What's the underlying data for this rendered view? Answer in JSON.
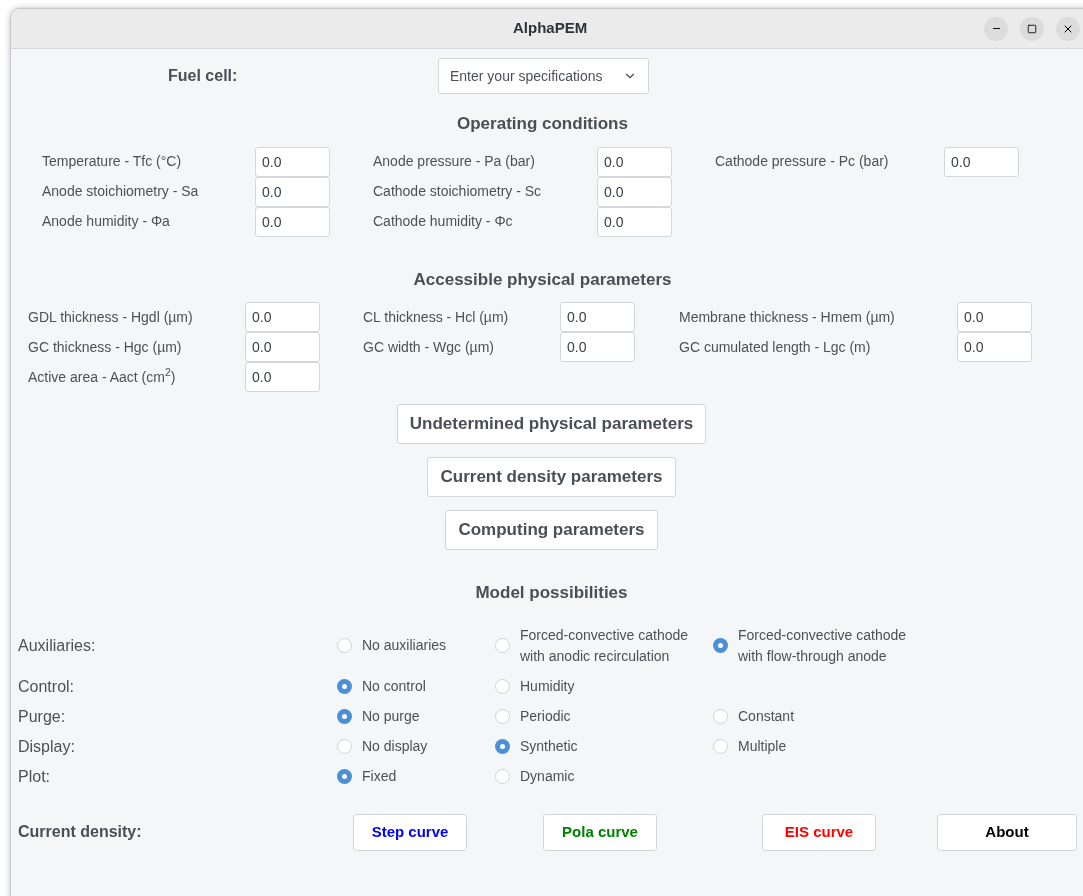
{
  "window": {
    "title": "AlphaPEM"
  },
  "fuel_cell": {
    "label": "Fuel cell:",
    "dropdown": {
      "value": "Enter your specifications"
    }
  },
  "operating_conditions": {
    "title": "Operating conditions",
    "fields": [
      {
        "label": "Temperature - Tfc (°C)",
        "value": "0.0"
      },
      {
        "label": "Anode pressure - Pa (bar)",
        "value": "0.0"
      },
      {
        "label": "Cathode pressure - Pc (bar)",
        "value": "0.0"
      },
      {
        "label": "Anode stoichiometry - Sa",
        "value": "0.0"
      },
      {
        "label": "Cathode stoichiometry - Sc",
        "value": "0.0"
      },
      {
        "label": "Anode humidity - Φa",
        "value": "0.0"
      },
      {
        "label": "Cathode humidity - Φc",
        "value": "0.0"
      }
    ]
  },
  "physical_parameters": {
    "title": "Accessible physical parameters",
    "fields": [
      {
        "label": "GDL thickness - Hgdl (µm)",
        "value": "0.0"
      },
      {
        "label": "CL thickness - Hcl (µm)",
        "value": "0.0"
      },
      {
        "label": "Membrane thickness - Hmem (µm)",
        "value": "0.0"
      },
      {
        "label": "GC thickness - Hgc (µm)",
        "value": "0.0"
      },
      {
        "label": "GC width - Wgc (µm)",
        "value": "0.0"
      },
      {
        "label": "GC cumulated length - Lgc (m)",
        "value": "0.0"
      },
      {
        "label": "Active area - Aact (cm$^{2}$)",
        "value": "0.0"
      }
    ]
  },
  "section_buttons": [
    "Undetermined physical parameters",
    "Current density parameters",
    "Computing parameters"
  ],
  "model_possibilities": {
    "title": "Model possibilities",
    "rows": [
      {
        "label": "Auxiliaries:",
        "options": [
          {
            "label": "No auxiliaries",
            "selected": false
          },
          {
            "label": "Forced-convective cathode\nwith anodic recirculation",
            "selected": false
          },
          {
            "label": "Forced-convective cathode\nwith flow-through anode",
            "selected": true
          }
        ]
      },
      {
        "label": "Control:",
        "options": [
          {
            "label": "No control",
            "selected": true
          },
          {
            "label": "Humidity",
            "selected": false
          }
        ]
      },
      {
        "label": "Purge:",
        "options": [
          {
            "label": "No purge",
            "selected": true
          },
          {
            "label": "Periodic",
            "selected": false
          },
          {
            "label": "Constant",
            "selected": false
          }
        ]
      },
      {
        "label": "Display:",
        "options": [
          {
            "label": "No display",
            "selected": false
          },
          {
            "label": "Synthetic",
            "selected": true
          },
          {
            "label": "Multiple",
            "selected": false
          }
        ]
      },
      {
        "label": "Plot:",
        "options": [
          {
            "label": "Fixed",
            "selected": true
          },
          {
            "label": "Dynamic",
            "selected": false
          }
        ]
      }
    ]
  },
  "current_density": {
    "label": "Current density:",
    "buttons": [
      {
        "label": "Step curve",
        "color": "#0000ff"
      },
      {
        "label": "Pola curve",
        "color": "#008000"
      },
      {
        "label": "EIS curve",
        "color": "#ff0000"
      },
      {
        "label": "About",
        "color": "#000000"
      }
    ]
  }
}
